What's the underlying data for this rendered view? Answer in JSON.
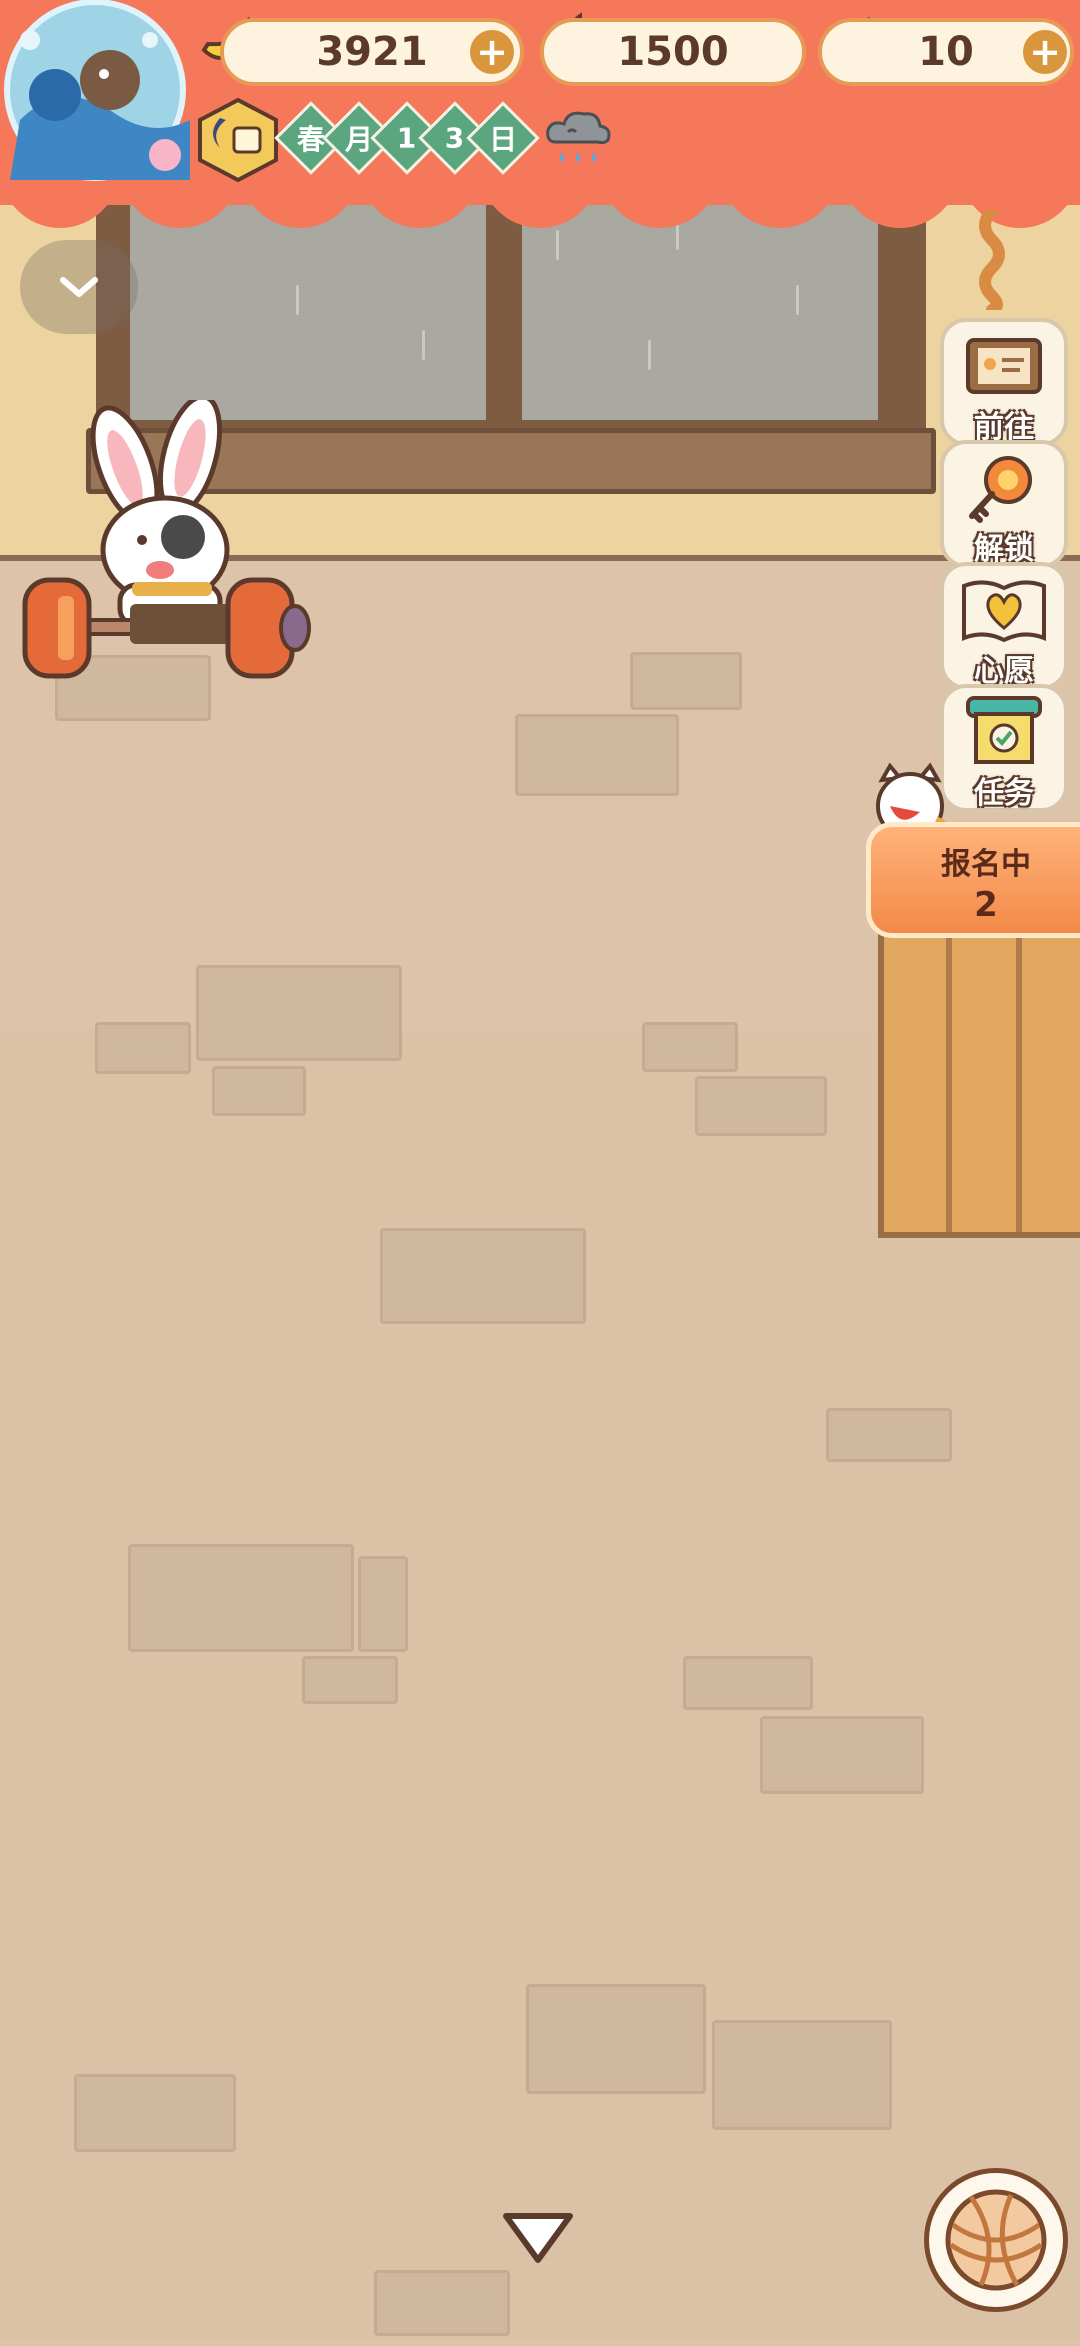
{
  "resources": {
    "banana": {
      "value": "3921",
      "icon": "banana-icon",
      "has_add": true
    },
    "flame": {
      "value": "1500",
      "icon": "flame-icon",
      "has_add": false
    },
    "blue_banana": {
      "value": "10",
      "icon": "blue-banana-icon",
      "has_add": true
    }
  },
  "date": {
    "tiles": [
      "春",
      "月",
      "1",
      "3",
      "日"
    ],
    "weather": "rain-cloud-icon",
    "moon": "moon-clock-icon"
  },
  "side_menu": {
    "items": [
      {
        "label": "前往",
        "icon": "signboard-icon"
      },
      {
        "label": "解锁",
        "icon": "key-icon"
      },
      {
        "label": "心愿",
        "icon": "wish-book-icon"
      },
      {
        "label": "任务",
        "icon": "task-scroll-icon"
      }
    ]
  },
  "signup": {
    "label": "报名中",
    "count": "2"
  },
  "colors": {
    "banner": "#f6785b",
    "accent": "#e79a53",
    "date_tile": "#5ba57f"
  }
}
